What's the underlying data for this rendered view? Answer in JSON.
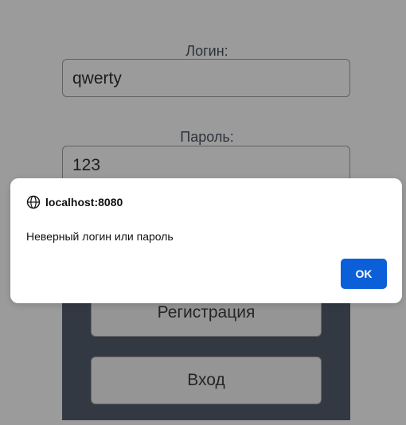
{
  "form": {
    "login_label": "Логин:",
    "login_value": "qwerty",
    "password_label": "Пароль:",
    "password_value": "123",
    "register_button": "Регистрация",
    "enter_button": "Вход"
  },
  "dialog": {
    "origin": "localhost:8080",
    "message": "Неверный логин или пароль",
    "ok_label": "OK",
    "icon": "globe-icon",
    "accent_color": "#0b5fd9"
  }
}
